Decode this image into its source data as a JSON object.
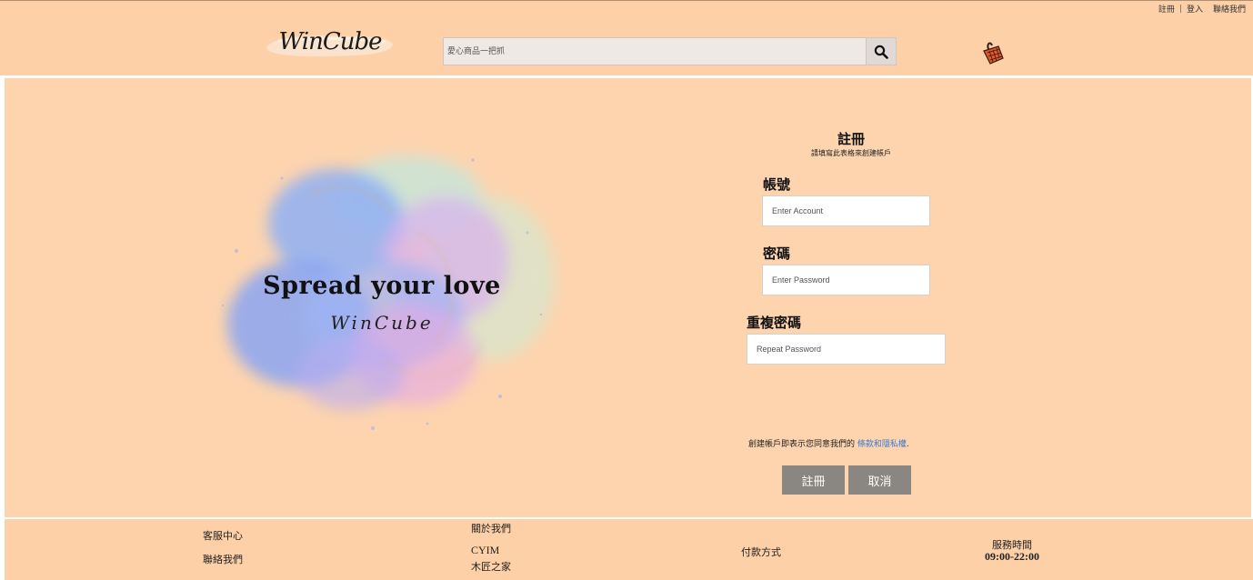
{
  "header": {
    "top_links": {
      "register": "註冊",
      "separator": "|",
      "login": "登入",
      "contact": "聯絡我們"
    },
    "logo_text": "WinCube",
    "search": {
      "placeholder": "愛心商品一把抓"
    },
    "icons": {
      "search": "search-icon",
      "cart": "basket-icon"
    }
  },
  "hero": {
    "title": "Spread your love",
    "subtitle": "WinCube"
  },
  "register_form": {
    "title": "註冊",
    "subtitle": "請填寫此表格來創建帳戶",
    "account_label": "帳號",
    "account_placeholder": "Enter Account",
    "password_label": "密碼",
    "password_placeholder": "Enter Password",
    "repeat_label": "重複密碼",
    "repeat_placeholder": "Repeat Password",
    "terms_text": "創建帳戶即表示您同意我們的",
    "terms_link": "條款和隱私權",
    "terms_end": ".",
    "submit_label": "註冊",
    "cancel_label": "取消"
  },
  "footer": {
    "customer_service": "客服中心",
    "contact_us": "聯絡我們",
    "about_us": "關於我們",
    "about_items": [
      "CYIM",
      "木匠之家"
    ],
    "payment": "付款方式",
    "service_hours_label": "服務時間",
    "service_hours_value": "09:00-22:00"
  },
  "colors": {
    "header_bg": "#fdd0a8",
    "main_bg": "#fdd4ae",
    "button_bg": "#8a8681",
    "link": "#3a7bd5"
  }
}
